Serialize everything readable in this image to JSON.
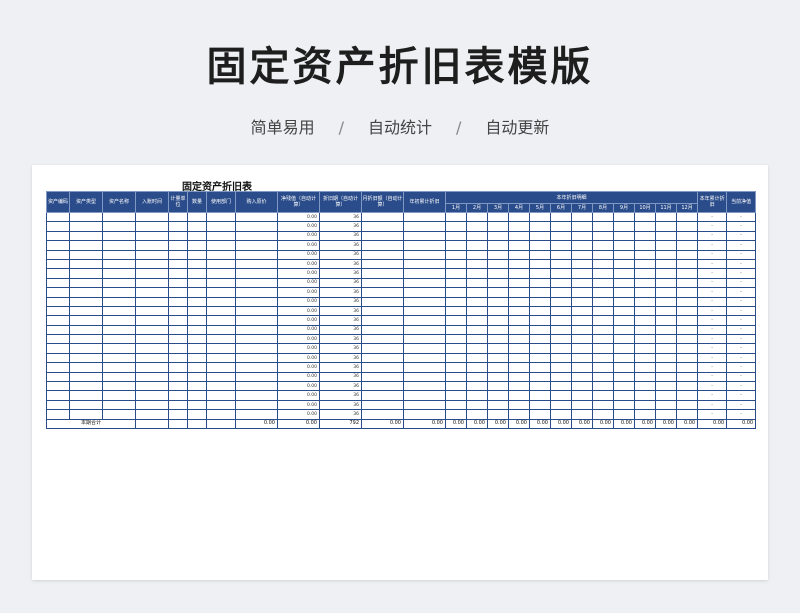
{
  "hero": {
    "title": "固定资产折旧表模版",
    "tag1": "简单易用",
    "sep1": "/",
    "tag2": "自动统计",
    "sep2": "/",
    "tag3": "自动更新"
  },
  "sheet": {
    "title": "固定资产折旧表",
    "headers": {
      "asset_code": "资产编码",
      "asset_type": "资产类型",
      "asset_name": "资产名称",
      "entry_time": "入账时间",
      "unit": "计量单位",
      "quantity": "数量",
      "department": "使用部门",
      "purchase_price": "购入原价",
      "residual": "净残值（自动计算）",
      "depreciation_period": "折旧期（自动计算）",
      "monthly_depreciation": "月折旧额（自动计算）",
      "prior_accumulated": "年初累计折旧",
      "current_year_detail": "本年折旧明细",
      "annual_accumulated": "本年累计折旧",
      "current_net": "当前净值"
    },
    "months": [
      "1月",
      "2月",
      "3月",
      "4月",
      "5月",
      "6月",
      "7月",
      "8月",
      "9月",
      "10月",
      "11月",
      "12月"
    ],
    "rows": [
      {
        "residual": "0.00",
        "period": "36",
        "accum": "-",
        "net": "-"
      },
      {
        "residual": "0.00",
        "period": "36",
        "accum": "-",
        "net": "-"
      },
      {
        "residual": "0.00",
        "period": "36",
        "accum": "-",
        "net": "-"
      },
      {
        "residual": "0.00",
        "period": "36",
        "accum": "-",
        "net": "-"
      },
      {
        "residual": "0.00",
        "period": "36",
        "accum": "-",
        "net": "-"
      },
      {
        "residual": "0.00",
        "period": "36",
        "accum": "-",
        "net": "-"
      },
      {
        "residual": "0.00",
        "period": "36",
        "accum": "-",
        "net": "-"
      },
      {
        "residual": "0.00",
        "period": "36",
        "accum": "-",
        "net": "-"
      },
      {
        "residual": "0.00",
        "period": "36",
        "accum": "-",
        "net": "-"
      },
      {
        "residual": "0.00",
        "period": "36",
        "accum": "-",
        "net": "-"
      },
      {
        "residual": "0.00",
        "period": "36",
        "accum": "-",
        "net": "-"
      },
      {
        "residual": "0.00",
        "period": "36",
        "accum": "-",
        "net": "-"
      },
      {
        "residual": "0.00",
        "period": "36",
        "accum": "-",
        "net": "-"
      },
      {
        "residual": "0.00",
        "period": "36",
        "accum": "-",
        "net": "-"
      },
      {
        "residual": "0.00",
        "period": "36",
        "accum": "-",
        "net": "-"
      },
      {
        "residual": "0.00",
        "period": "36",
        "accum": "-",
        "net": "-"
      },
      {
        "residual": "0.00",
        "period": "36",
        "accum": "-",
        "net": "-"
      },
      {
        "residual": "0.00",
        "period": "36",
        "accum": "-",
        "net": "-"
      },
      {
        "residual": "0.00",
        "period": "36",
        "accum": "-",
        "net": "-"
      },
      {
        "residual": "0.00",
        "period": "36",
        "accum": "-",
        "net": "-"
      },
      {
        "residual": "0.00",
        "period": "36",
        "accum": "-",
        "net": "-"
      },
      {
        "residual": "0.00",
        "period": "36",
        "accum": "-",
        "net": "-"
      }
    ],
    "totals": {
      "label": "本期合计",
      "purchase_price": "0.00",
      "residual": "0.00",
      "period": "792",
      "monthly": "0.00",
      "prior": "0.00",
      "months": [
        "0.00",
        "0.00",
        "0.00",
        "0.00",
        "0.00",
        "0.00",
        "0.00",
        "0.00",
        "0.00",
        "0.00",
        "0.00",
        "0.00"
      ],
      "accum": "0.00",
      "net": "0.00"
    }
  }
}
